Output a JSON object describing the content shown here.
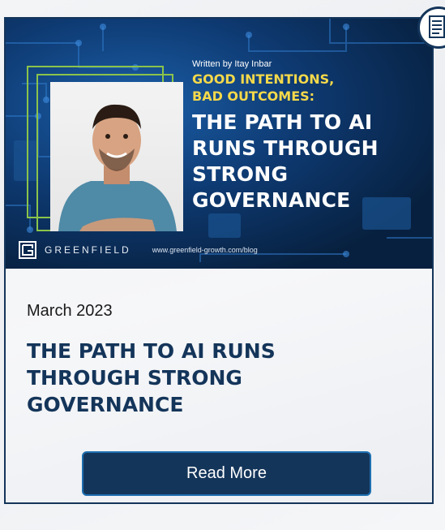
{
  "hero": {
    "written_by": "Written by Itay Inbar",
    "subtitle_lines": [
      "GOOD INTENTIONS,",
      "BAD OUTCOMES:"
    ],
    "headline_lines": [
      "THE PATH TO AI",
      "RUNS THROUGH",
      "STRONG",
      "GOVERNANCE"
    ],
    "brand": "GREENFIELD",
    "url": "www.greenfield-growth.com/blog"
  },
  "post": {
    "date": "March 2023",
    "title_lines": [
      "THE PATH TO AI RUNS",
      "THROUGH STRONG",
      "GOVERNANCE"
    ],
    "read_more": "Read More"
  },
  "colors": {
    "navy": "#14355a",
    "accent_yellow": "#f5d94a",
    "frame_green": "#8bc34a"
  },
  "icons": {
    "badge": "document-icon",
    "brand": "greenfield-logo-icon"
  }
}
